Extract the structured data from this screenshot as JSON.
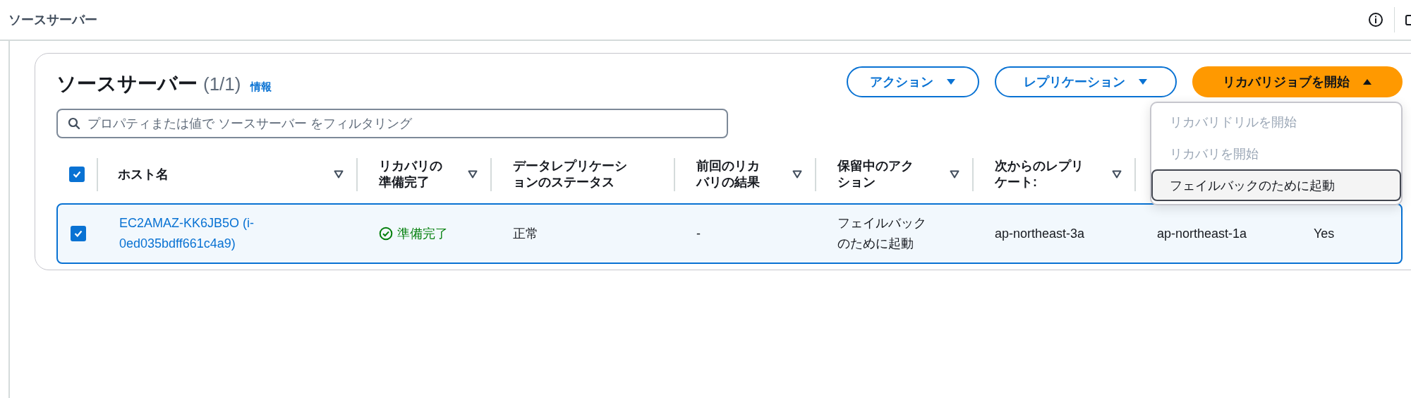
{
  "top_bar": {
    "title": "ソースサーバー"
  },
  "panel": {
    "title": "ソースサーバー",
    "count": "(1/1)",
    "info_link": "情報",
    "buttons": [
      {
        "label": "アクション",
        "kind": "normal",
        "expanded": false
      },
      {
        "label": "レプリケーション",
        "kind": "normal",
        "expanded": false
      },
      {
        "label": "リカバリジョブを開始",
        "kind": "primary",
        "expanded": true
      }
    ],
    "menu": {
      "items": [
        {
          "label": "リカバリドリルを開始",
          "disabled": true,
          "highlighted": false
        },
        {
          "label": "リカバリを開始",
          "disabled": true,
          "highlighted": false
        },
        {
          "label": "フェイルバックのために起動",
          "disabled": false,
          "highlighted": true
        }
      ]
    },
    "search": {
      "placeholder": "プロパティまたは値で ソースサーバー をフィルタリング"
    },
    "table": {
      "select_all_checked": true,
      "columns": [
        {
          "label": "ホスト名",
          "sortable": true
        },
        {
          "label": "リカバリの準備完了",
          "sortable": true
        },
        {
          "label": "データレプリケーションのステータス",
          "sortable": false
        },
        {
          "label": "前回のリカバリの結果",
          "sortable": true
        },
        {
          "label": "保留中のアクション",
          "sortable": true
        },
        {
          "label": "次からのレプリケート:",
          "sortable": true
        }
      ],
      "rows": [
        {
          "checked": true,
          "selected": true,
          "cells": [
            {
              "kind": "link",
              "text": "EC2AMAZ-KK6JB5O (i-0ed035bdff661c4a9)"
            },
            {
              "kind": "success",
              "text": "準備完了"
            },
            {
              "kind": "text",
              "text": "正常"
            },
            {
              "kind": "text",
              "text": "-"
            },
            {
              "kind": "text",
              "text": "フェイルバックのために起動"
            },
            {
              "kind": "text",
              "text": "ap-northeast-3a"
            },
            {
              "kind": "text",
              "text": "ap-northeast-1a"
            },
            {
              "kind": "text",
              "text": "Yes"
            }
          ]
        }
      ]
    }
  }
}
